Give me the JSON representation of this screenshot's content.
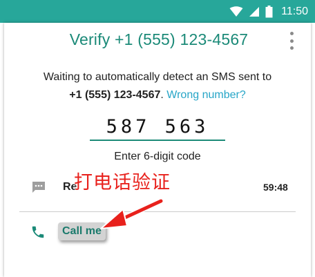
{
  "status_bar": {
    "time": "11:50",
    "background": "#27a79a"
  },
  "header": {
    "title": "Verify +1 (555) 123-4567",
    "menu_icon": "more-vert-icon"
  },
  "description": {
    "line1": "Waiting to automatically detect an SMS sent to",
    "phone": "+1 (555) 123-4567",
    "separator": ".",
    "wrong_number_link": "Wrong number?"
  },
  "code_input": {
    "value": "587 563",
    "hint": "Enter 6-digit code"
  },
  "resend_row": {
    "label": "Re",
    "timer": "59:48",
    "icon": "sms-icon"
  },
  "call_row": {
    "label": "Call me",
    "icon": "phone-icon"
  },
  "annotation": {
    "text": "打电话验证",
    "color": "#e8211c"
  },
  "colors": {
    "accent": "#1b8a78",
    "link": "#26a5c7"
  }
}
